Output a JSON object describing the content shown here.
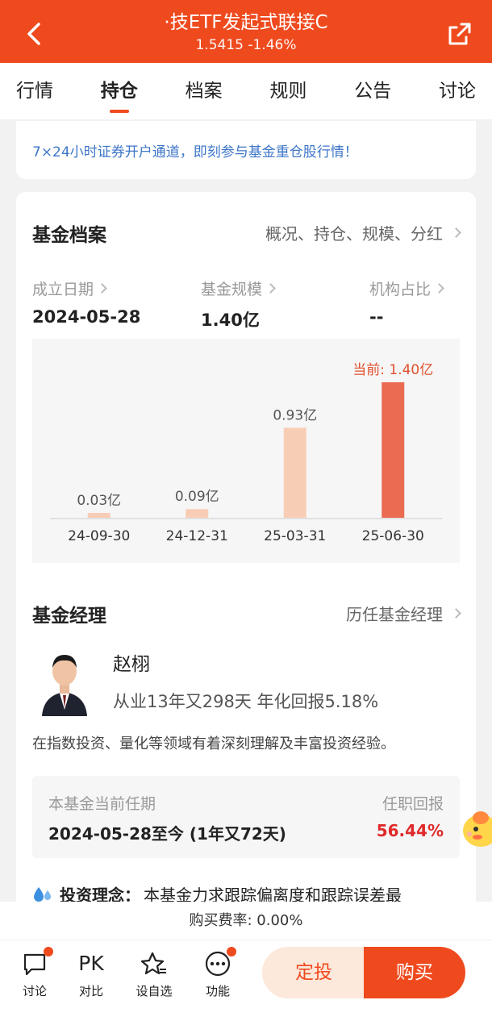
{
  "header": {
    "title": "·技ETF发起式联接C",
    "subtitle": "1.5415  -1.46%"
  },
  "tabs": [
    {
      "label": "行情"
    },
    {
      "label": "持仓"
    },
    {
      "label": "档案"
    },
    {
      "label": "规则"
    },
    {
      "label": "公告"
    },
    {
      "label": "讨论"
    }
  ],
  "promo": {
    "text": "7×24小时证券开户通道，即刻参与基金重仓股行情！"
  },
  "fund_profile": {
    "title": "基金档案",
    "link": "概况、持仓、规模、分红",
    "stats": [
      {
        "label": "成立日期",
        "value": "2024-05-28"
      },
      {
        "label": "基金规模",
        "value": "1.40亿"
      },
      {
        "label": "机构占比",
        "value": "--"
      }
    ]
  },
  "chart_data": {
    "type": "bar",
    "categories": [
      "24-09-30",
      "24-12-31",
      "25-03-31",
      "25-06-30"
    ],
    "values": [
      0.03,
      0.09,
      0.93,
      1.4
    ],
    "labels": [
      "0.03亿",
      "0.09亿",
      "0.93亿",
      "当前: 1.40亿"
    ],
    "colors": [
      "#f8cdb5",
      "#f8cdb5",
      "#f8cdb5",
      "#ea6a52"
    ],
    "ylim": [
      0,
      1.4
    ]
  },
  "manager": {
    "title": "基金经理",
    "link": "历任基金经理",
    "name": "赵栩",
    "meta": "从业13年又298天  年化回报5.18%",
    "desc": "在指数投资、量化等领域有着深刻理解及丰富投资经验。",
    "tenure_label": "本基金当前任期",
    "tenure_value": "2024-05-28至今 (1年又72天)",
    "return_label": "任职回报",
    "return_value": "56.44%",
    "philosophy_label": "投资理念：",
    "philosophy_text": "本基金力求跟踪偏离度和跟踪误差最"
  },
  "fee": {
    "text": "购买费率: 0.00%"
  },
  "bottom_nav": {
    "items": [
      {
        "label": "讨论",
        "icon": "chat-icon"
      },
      {
        "label": "对比",
        "icon": "pk-icon",
        "glyph": "PK"
      },
      {
        "label": "设自选",
        "icon": "star-icon"
      },
      {
        "label": "功能",
        "icon": "more-icon"
      }
    ],
    "dingtou": "定投",
    "buy": "购买"
  },
  "colors": {
    "accent": "#ef4a1e",
    "link_blue": "#3d76c8",
    "return_red": "#e02a2a"
  }
}
